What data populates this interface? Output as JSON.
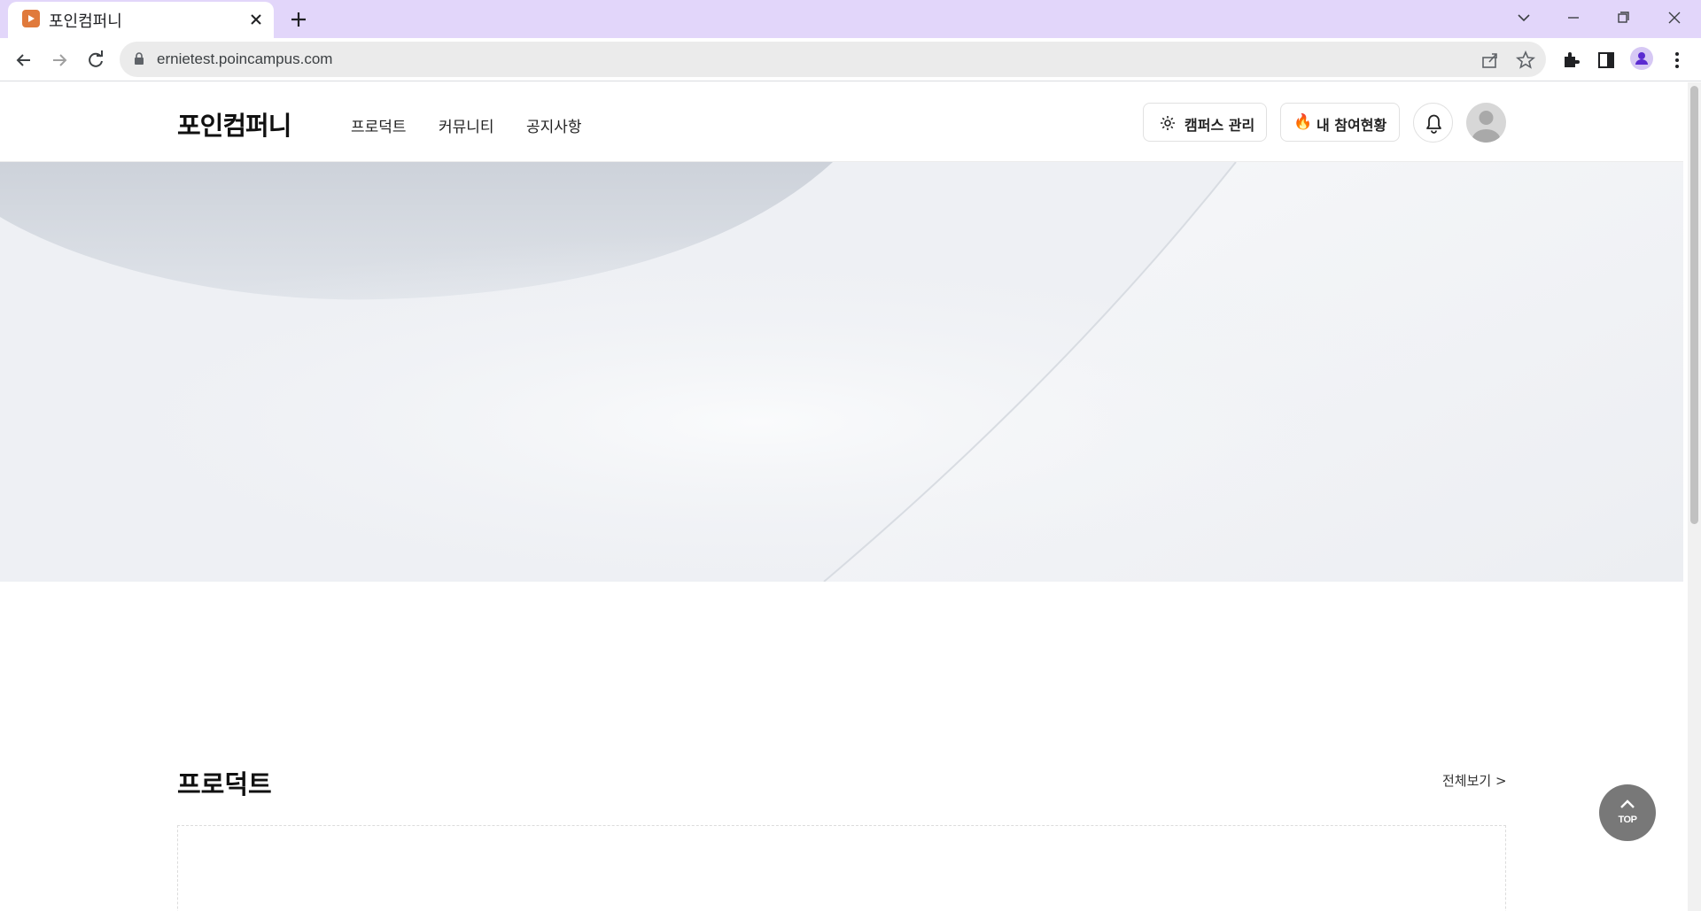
{
  "browser": {
    "tab_title": "포인컴퍼니",
    "url": "ernietest.poincampus.com"
  },
  "header": {
    "logo": "포인컴퍼니",
    "nav": [
      "프로덕트",
      "커뮤니티",
      "공지사항"
    ],
    "campus_admin_label": "캠퍼스 관리",
    "my_participation_label": "내 참여현황",
    "my_participation_icon": "🔥"
  },
  "product_section": {
    "title": "프로덕트",
    "view_all": "전체보기 >"
  },
  "top_button": {
    "label": "TOP"
  },
  "colors": {
    "tabstrip": "#e2d6fa",
    "favicon": "#e07a3c",
    "top_button": "#787878"
  }
}
